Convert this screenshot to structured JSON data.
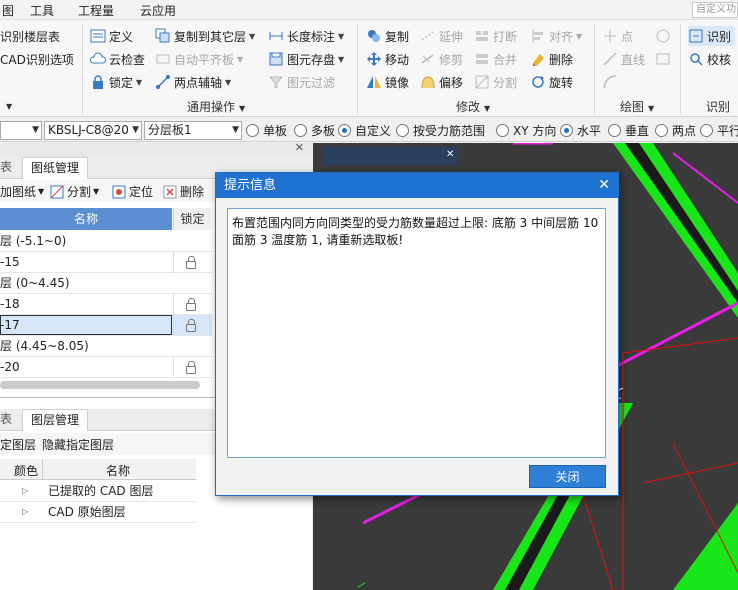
{
  "menu": {
    "items": [
      "图",
      "工具",
      "工程量",
      "云应用"
    ],
    "search_placeholder": "自定义功"
  },
  "ribbon": {
    "identify": {
      "floors": "识别楼层表",
      "cad_options": "CAD识别选项"
    },
    "common": {
      "define": "定义",
      "copy_other": "复制到其它层",
      "length": "长度标注",
      "cloud_check": "云检查",
      "auto_align": "自动平齐板",
      "save_element": "图元存盘",
      "lock": "锁定",
      "two_point": "两点辅轴",
      "filter": "图元过滤",
      "group": "通用操作"
    },
    "modify": {
      "copy": "复制",
      "extend": "延伸",
      "break": "打断",
      "align": "对齐",
      "move": "移动",
      "trim": "修剪",
      "merge": "合并",
      "delete": "删除",
      "mirror": "镜像",
      "offset": "偏移",
      "split": "分割",
      "rotate": "旋转",
      "group": "修改"
    },
    "draw": {
      "point": "点",
      "line": "直线",
      "group": "绘图"
    },
    "recognize": {
      "identify": "识别",
      "check": "校核",
      "group": "识别板"
    }
  },
  "filterbar": {
    "combo1": "",
    "combo2": "KBSLJ-C8@20",
    "combo3": "分层板1",
    "radios": [
      "单板",
      "多板",
      "自定义",
      "按受力筋范围",
      "XY 方向",
      "水平",
      "垂直",
      "两点",
      "平行"
    ]
  },
  "drawing_panel": {
    "tabs": [
      "表",
      "图纸管理"
    ],
    "tools": {
      "add": "加图纸",
      "split": "分割",
      "locate": "定位",
      "delete": "删除"
    },
    "columns": {
      "name": "名称",
      "lock": "锁定"
    },
    "rows": [
      {
        "name": "层 (-5.1~0)",
        "group": true
      },
      {
        "name": "-15",
        "group": false
      },
      {
        "name": "层 (0~4.45)",
        "group": true
      },
      {
        "name": "-18",
        "group": false
      },
      {
        "name": "-17",
        "group": false
      },
      {
        "name": "层 (4.45~8.05)",
        "group": true
      },
      {
        "name": "-20",
        "group": false
      }
    ]
  },
  "layer_panel": {
    "tabs": [
      "表",
      "图层管理"
    ],
    "tools": {
      "show_layer": "定图层",
      "hide_layer": "隐藏指定图层"
    },
    "columns": {
      "color": "颜色",
      "name": "名称"
    },
    "rows": [
      {
        "name": "已提取的 CAD 图层"
      },
      {
        "name": "CAD 原始图层"
      }
    ]
  },
  "dialog": {
    "title": "提示信息",
    "message": "布置范围内同方向同类型的受力筋数量超过上限: 底筋 3 中间层筋 10 面筋 3 温度筋 1, 请重新选取板!",
    "close_label": "关闭"
  },
  "colors": {
    "accent": "#1f72d1",
    "canvas": "#3a3a3a",
    "green": "#19e619",
    "magenta": "#e81ee8"
  }
}
